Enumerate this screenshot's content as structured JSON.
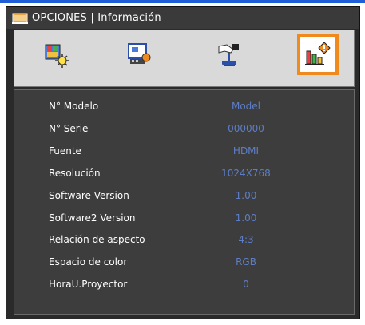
{
  "window": {
    "title": "OPCIONES | Información"
  },
  "tabs": [
    {
      "icon": "picture-settings-icon",
      "active": false
    },
    {
      "icon": "screen-settings-icon",
      "active": false
    },
    {
      "icon": "setup-icon",
      "active": false
    },
    {
      "icon": "info-icon",
      "active": true
    }
  ],
  "info": {
    "rows": [
      {
        "label": "N° Modelo",
        "value": "Model"
      },
      {
        "label": "N° Serie",
        "value": "000000"
      },
      {
        "label": "Fuente",
        "value": "HDMI"
      },
      {
        "label": "Resolución",
        "value": "1024X768"
      },
      {
        "label": "Software Version",
        "value": "1.00"
      },
      {
        "label": "Software2 Version",
        "value": "1.00"
      },
      {
        "label": "Relación de aspecto",
        "value": "4:3"
      },
      {
        "label": "Espacio de color",
        "value": "RGB"
      },
      {
        "label": "HoraU.Proyector",
        "value": "0"
      }
    ]
  },
  "colors": {
    "accent": "#f08a1c",
    "value_text": "#5d7ec7",
    "topline": "#1e5fd8"
  }
}
